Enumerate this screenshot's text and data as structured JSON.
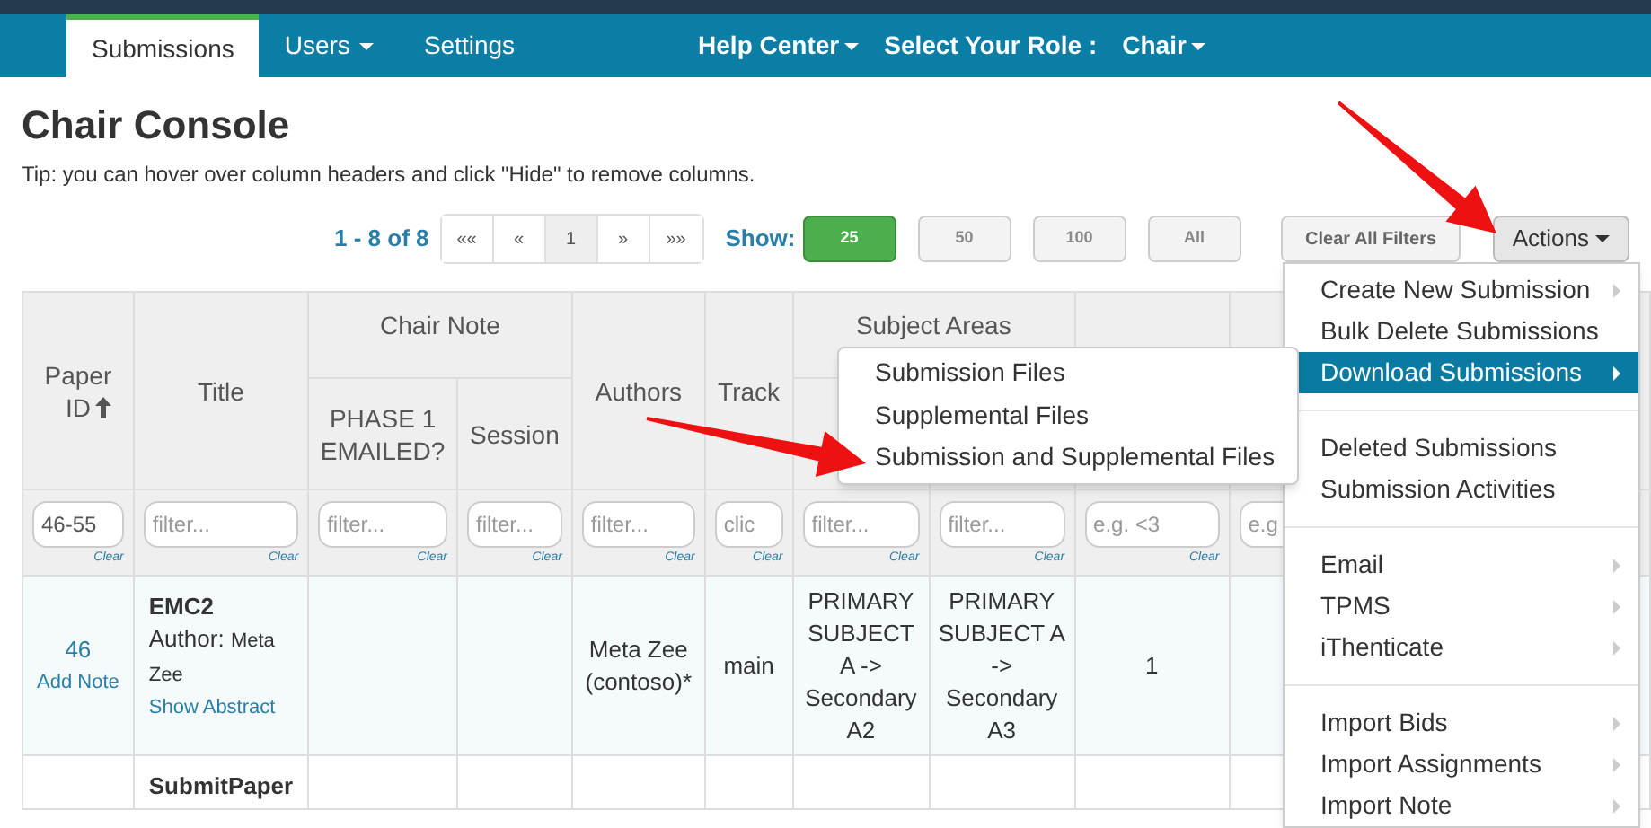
{
  "nav": {
    "tabs": [
      {
        "label": "Submissions",
        "selected": true,
        "dropdown": false
      },
      {
        "label": "Users",
        "selected": false,
        "dropdown": true
      },
      {
        "label": "Settings",
        "selected": false,
        "dropdown": false
      }
    ],
    "right": [
      {
        "label": "Help Center",
        "kind": "menu"
      },
      {
        "label": "Select Your Role :",
        "kind": "label"
      },
      {
        "label": "Chair",
        "kind": "menu"
      }
    ]
  },
  "page": {
    "title": "Chair Console",
    "tip": "Tip: you can hover over column headers and click \"Hide\" to remove columns."
  },
  "pager": {
    "range": "1 - 8 of 8",
    "buttons": [
      {
        "label": "««",
        "selected": false
      },
      {
        "label": "«",
        "selected": false
      },
      {
        "label": "1",
        "selected": true
      },
      {
        "label": "»",
        "selected": false
      },
      {
        "label": "»»",
        "selected": false
      }
    ],
    "show_label": "Show:",
    "sizes": [
      {
        "label": "25",
        "selected": true
      },
      {
        "label": "50",
        "selected": false
      },
      {
        "label": "100",
        "selected": false
      },
      {
        "label": "All",
        "selected": false
      }
    ],
    "clear_filters": "Clear All Filters",
    "actions": "Actions"
  },
  "table": {
    "column_groups": [
      {
        "label": "Chair Note"
      },
      {
        "label": "Subject Areas"
      }
    ],
    "columns": [
      {
        "header": "Paper ID",
        "sorted": true,
        "filter": {
          "value": "46-55",
          "clear": "Clear"
        }
      },
      {
        "header": "Title",
        "filter": {
          "placeholder": "filter...",
          "clear": "Clear"
        }
      },
      {
        "group_start": true,
        "header": "PHASE 1 EMAILED?",
        "filter": {
          "placeholder": "filter...",
          "clear": "Clear"
        }
      },
      {
        "in_group": true,
        "header": "Session",
        "filter": {
          "placeholder": "filter...",
          "clear": "Clear"
        }
      },
      {
        "header": "Authors",
        "filter": {
          "placeholder": "filter...",
          "clear": "Clear"
        }
      },
      {
        "header": "Track",
        "filter": {
          "placeholder": "clic",
          "clear": "Clear"
        }
      },
      {
        "group_start": true,
        "filter": {
          "placeholder": "filter...",
          "clear": "Clear"
        }
      },
      {
        "in_group": true,
        "filter": {
          "placeholder": "filter...",
          "clear": "Clear"
        }
      },
      {
        "filter": {
          "placeholder": "e.g. <3",
          "clear": "Clear"
        }
      },
      {
        "filter": {
          "placeholder": "e.g"
        }
      },
      {}
    ],
    "rows": [
      {
        "cells": [
          {
            "kind": "id",
            "text": "46",
            "link": "Add Note"
          },
          {
            "kind": "title",
            "text": "EMC2",
            "author_label": "Author:",
            "author": "Meta Zee",
            "link": "Show Abstract"
          },
          {},
          {},
          {
            "text": "Meta Zee (contoso)*"
          },
          {
            "text": "main"
          },
          {
            "text": "PRIMARY SUBJECT A -> Secondary A2"
          },
          {
            "text": "PRIMARY SUBJECT A -> Secondary A3"
          },
          {
            "text": "1"
          },
          {},
          {}
        ]
      },
      {
        "cells": [
          {},
          {
            "kind": "title",
            "text": "SubmitPaper"
          },
          {},
          {},
          {},
          {},
          {},
          {},
          {},
          {},
          {}
        ]
      }
    ]
  },
  "actions_menu": {
    "items": [
      {
        "kind": "item",
        "label": "Create New Submission",
        "submenu": true,
        "selected": false
      },
      {
        "kind": "item",
        "label": "Bulk Delete Submissions",
        "submenu": false,
        "selected": false
      },
      {
        "kind": "item",
        "label": "Download Submissions",
        "submenu": true,
        "selected": true
      },
      {
        "kind": "divider"
      },
      {
        "kind": "item",
        "label": "Deleted Submissions",
        "submenu": false,
        "selected": false
      },
      {
        "kind": "item",
        "label": "Submission Activities",
        "submenu": false,
        "selected": false
      },
      {
        "kind": "divider"
      },
      {
        "kind": "item",
        "label": "Email",
        "submenu": true,
        "selected": false
      },
      {
        "kind": "item",
        "label": "TPMS",
        "submenu": true,
        "selected": false
      },
      {
        "kind": "item",
        "label": "iThenticate",
        "submenu": true,
        "selected": false
      },
      {
        "kind": "divider"
      },
      {
        "kind": "item",
        "label": "Import Bids",
        "submenu": true,
        "selected": false
      },
      {
        "kind": "item",
        "label": "Import Assignments",
        "submenu": true,
        "selected": false
      },
      {
        "kind": "item",
        "label": "Import Note",
        "submenu": true,
        "selected": false
      }
    ]
  },
  "download_submenu": {
    "items": [
      "Submission Files",
      "Supplemental Files",
      "Submission and Supplemental Files"
    ]
  },
  "callouts": [
    {
      "kind": "arrow"
    },
    {
      "kind": "arrow"
    }
  ]
}
